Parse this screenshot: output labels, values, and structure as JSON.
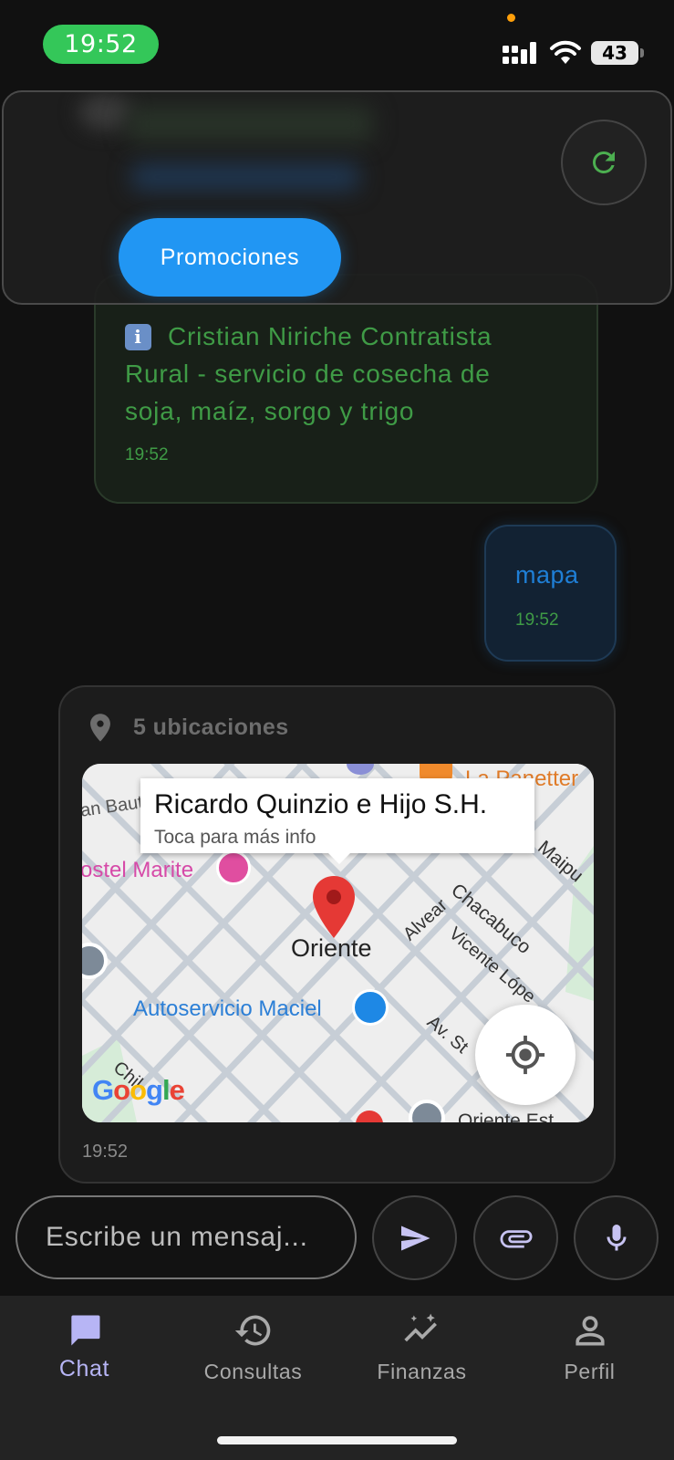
{
  "status_bar": {
    "time": "19:52",
    "battery": "43"
  },
  "promo_panel": {
    "promo_button": "Promociones"
  },
  "messages": {
    "info": {
      "emoji": "i",
      "text": "Cristian Niriche Contratista Rural - servicio de cosecha de soja, maíz, sorgo y trigo",
      "time": "19:52"
    },
    "user": {
      "text": "mapa",
      "time": "19:52"
    },
    "map": {
      "header": "5 ubicaciones",
      "time": "19:52",
      "tooltip_title": "Ricardo Quinzio e Hijo S.H.",
      "tooltip_subtitle": "Toca para más info",
      "labels": {
        "san_bautista": "an Baut",
        "panetteria": "La Panetter",
        "hostel": "ostel Marite",
        "chacabuco": "Chacabuco",
        "maipu": "Maipu",
        "alvear": "Alvear",
        "oriente": "Oriente",
        "vicente_lopez": "Vicente Lópe",
        "autoservicio": "Autoservicio Maciel",
        "av_st": "Av. St",
        "chil": "Chil",
        "oriente_bottom": "Oriente Est"
      },
      "google_logo": "Google"
    }
  },
  "composer": {
    "placeholder": "Escribe un mensaj..."
  },
  "nav": [
    {
      "label": "Chat",
      "active": true
    },
    {
      "label": "Consultas"
    },
    {
      "label": "Finanzas"
    },
    {
      "label": "Perfil"
    }
  ],
  "colors": {
    "accent": "#2196f3",
    "bot_text": "#3f9b46",
    "user_text": "#1f7fd6",
    "nav_active": "#b7b5f5",
    "status_green": "#34c759"
  }
}
